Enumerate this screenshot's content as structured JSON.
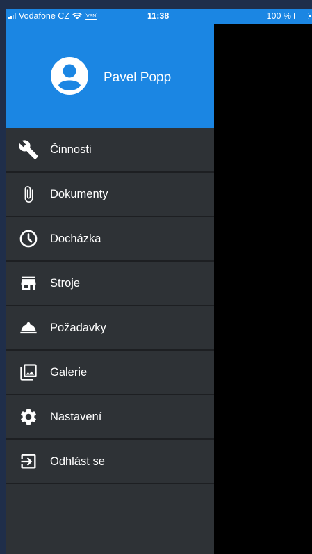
{
  "status_bar": {
    "carrier": "Vodafone CZ",
    "vpn": "VPN",
    "time": "11:38",
    "battery": "100 %"
  },
  "user": {
    "name": "Pavel Popp"
  },
  "menu": [
    {
      "label": "Činnosti",
      "icon": "wrench-icon"
    },
    {
      "label": "Dokumenty",
      "icon": "paperclip-icon"
    },
    {
      "label": "Docházka",
      "icon": "clock-icon"
    },
    {
      "label": "Stroje",
      "icon": "store-icon"
    },
    {
      "label": "Požadavky",
      "icon": "service-bell-icon"
    },
    {
      "label": "Galerie",
      "icon": "gallery-icon"
    },
    {
      "label": "Nastavení",
      "icon": "gear-icon"
    },
    {
      "label": "Odhlást se",
      "icon": "logout-icon"
    }
  ],
  "colors": {
    "accent": "#1b86e3",
    "drawer_bg": "#2e3236",
    "divider": "#1d1f22",
    "overlay": "#000000"
  }
}
